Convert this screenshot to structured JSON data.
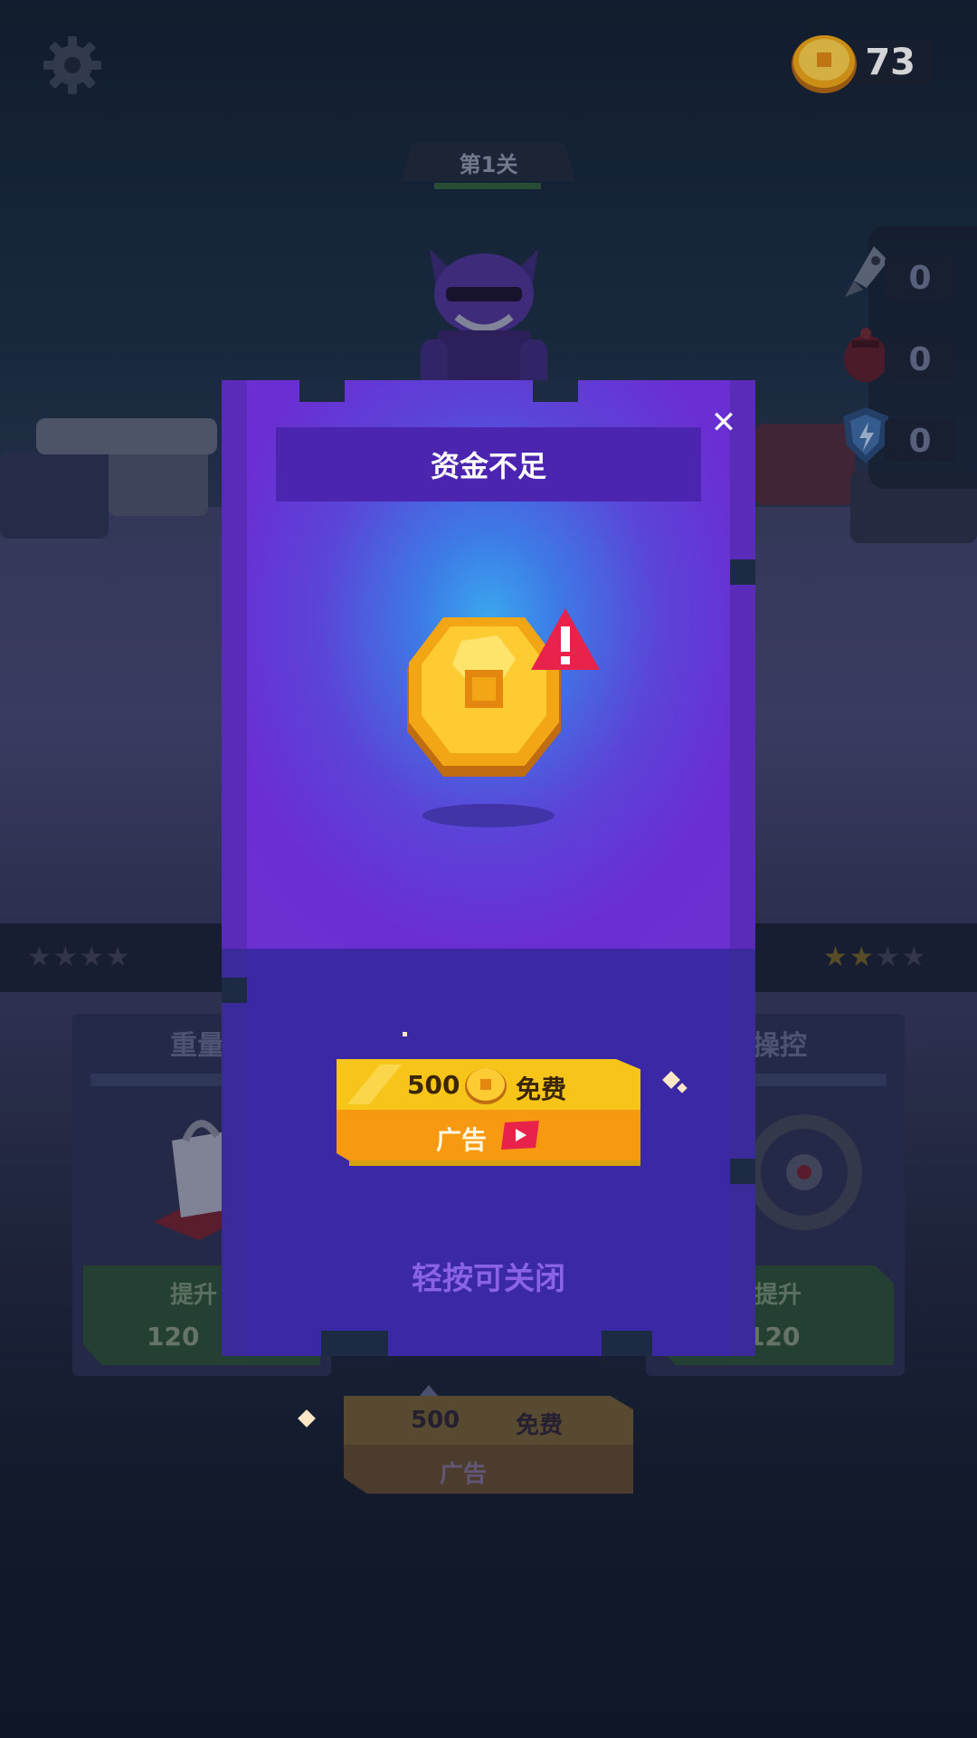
{
  "topbar": {
    "settings_icon": "gear-icon",
    "coin_icon": "gold-coin-icon",
    "coins": "73",
    "level_label": "第1关",
    "level_progress": 1.0
  },
  "powerups": [
    {
      "icon": "rocket-icon",
      "count": "0"
    },
    {
      "icon": "bomb-icon",
      "count": "0"
    },
    {
      "icon": "shield-icon",
      "count": "0"
    }
  ],
  "stats": {
    "left_stars": 0,
    "right_stars": 2,
    "max_stars": 4
  },
  "cards": [
    {
      "title": "重量",
      "icon": "weight-bag-icon",
      "button": "提升",
      "price": "120"
    },
    {
      "title": "操控",
      "icon": "steering-wheel-icon",
      "button": "提升",
      "price": "120"
    }
  ],
  "background_ad": {
    "amount": "500",
    "free_label": "免费",
    "ad_label": "广告"
  },
  "popup": {
    "title": "资金不足",
    "close_icon": "close-icon",
    "main_icon": "gold-coin-icon",
    "warning_icon": "warning-triangle-icon",
    "ad_button": {
      "amount": "500",
      "free_label": "免费",
      "ad_label": "广告",
      "video_icon": "play-video-icon"
    },
    "tap_to_close": "轻按可关闭"
  },
  "colors": {
    "popup_purple": "#6a30cf",
    "popup_glow": "#3aa7ee",
    "button_yellow": "#f7c41a",
    "button_orange": "#f79a12",
    "warning_red": "#e8224a"
  }
}
